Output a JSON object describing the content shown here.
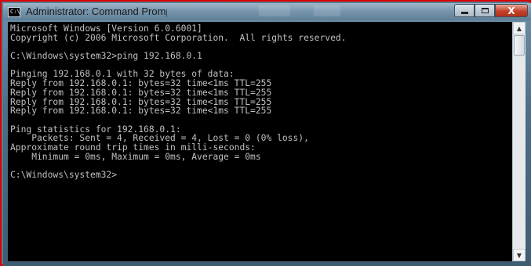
{
  "window": {
    "title": "Administrator: Command Prompt",
    "icon": "cmd-icon",
    "buttons": {
      "minimize": "minimize-icon",
      "maximize": "maximize-icon",
      "close_label": "X"
    }
  },
  "console": {
    "lines": [
      "Microsoft Windows [Version 6.0.6001]",
      "Copyright (c) 2006 Microsoft Corporation.  All rights reserved.",
      "",
      "C:\\Windows\\system32>ping 192.168.0.1",
      "",
      "Pinging 192.168.0.1 with 32 bytes of data:",
      "Reply from 192.168.0.1: bytes=32 time<1ms TTL=255",
      "Reply from 192.168.0.1: bytes=32 time<1ms TTL=255",
      "Reply from 192.168.0.1: bytes=32 time<1ms TTL=255",
      "Reply from 192.168.0.1: bytes=32 time<1ms TTL=255",
      "",
      "Ping statistics for 192.168.0.1:",
      "    Packets: Sent = 4, Received = 4, Lost = 0 (0% loss),",
      "Approximate round trip times in milli-seconds:",
      "    Minimum = 0ms, Maximum = 0ms, Average = 0ms",
      "",
      "C:\\Windows\\system32>"
    ]
  },
  "scrollbar": {
    "up_arrow": "▲",
    "down_arrow": "▼"
  },
  "colors": {
    "console_bg": "#000000",
    "console_text": "#c0c0c0",
    "close_button": "#c5412a",
    "highlight_border": "#dd0000"
  }
}
